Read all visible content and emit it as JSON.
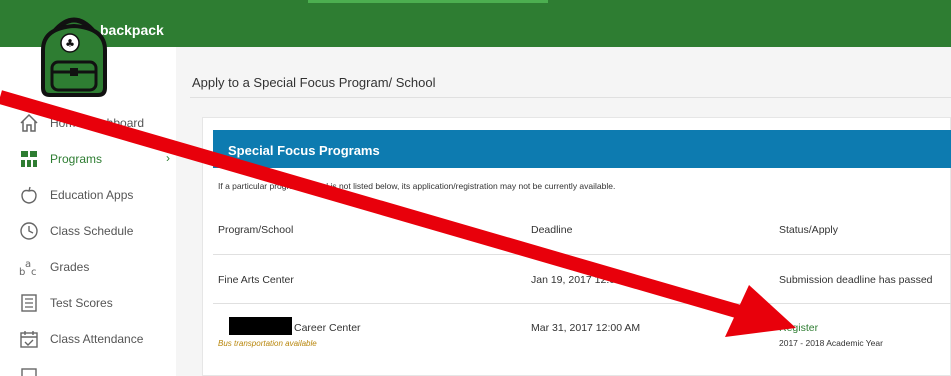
{
  "app": {
    "name": "backpack"
  },
  "colors": {
    "topbar": "#2e7d32",
    "header": "#0d7bb0",
    "accent": "#2e7d32",
    "bus": "#b8860b",
    "arrow": "#e8000b"
  },
  "sidebar": {
    "items": [
      {
        "label": "Home/Dashboard",
        "icon": "home-icon"
      },
      {
        "label": "Programs",
        "icon": "programs-icon",
        "active": true
      },
      {
        "label": "Education Apps",
        "icon": "apple-icon"
      },
      {
        "label": "Class Schedule",
        "icon": "clock-icon"
      },
      {
        "label": "Grades",
        "icon": "abc-icon"
      },
      {
        "label": "Test Scores",
        "icon": "test-icon"
      },
      {
        "label": "Class Attendance",
        "icon": "calendar-icon"
      }
    ]
  },
  "main": {
    "title": "Apply to a Special Focus Program/ School",
    "card": {
      "header": "Special Focus Programs",
      "note": "If a particular program/school is not listed below, its application/registration may not be currently available.",
      "columns": [
        "Program/School",
        "Deadline",
        "Status/Apply"
      ],
      "rows": [
        {
          "program": "Fine Arts Center",
          "deadline": "Jan 19, 2017 12:00 AM",
          "status": "Submission deadline has passed"
        },
        {
          "program": "Career Center",
          "sub": "Bus transportation available",
          "deadline": "Mar 31, 2017 12:00 AM",
          "status": "Register",
          "status_sub": "2017 - 2018 Academic Year"
        }
      ]
    }
  }
}
